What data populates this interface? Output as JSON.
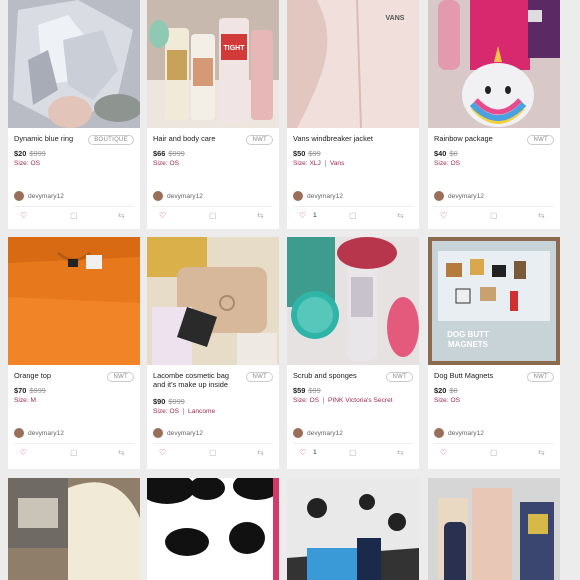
{
  "cards": [
    {
      "title": "Dynamic blue ring",
      "badge": "BOUTIQUE",
      "price": "$20",
      "orig": "$999",
      "size": "Size: OS",
      "brand": "",
      "seller": "devymary12",
      "likes": "",
      "img": "ice",
      "icons": {
        "like": "heart-icon",
        "comment": "comment-icon",
        "share": "share-icon"
      }
    },
    {
      "title": "Hair and body care",
      "badge": "NWT",
      "price": "$66",
      "orig": "$999",
      "size": "Size: OS",
      "brand": "",
      "seller": "devymary12",
      "likes": "",
      "img": "bottles"
    },
    {
      "title": "Vans windbreaker jacket",
      "badge": "",
      "price": "$50",
      "orig": "$99",
      "size": "Size: XLJ",
      "brand": "Vans",
      "seller": "devymary12",
      "likes": "1",
      "img": "pink"
    },
    {
      "title": "Rainbow package",
      "badge": "NWT",
      "price": "$40",
      "orig": "$0",
      "size": "Size: OS",
      "brand": "",
      "seller": "devymary12",
      "likes": "",
      "img": "unicorn"
    },
    {
      "title": "Orange top",
      "badge": "NWT",
      "price": "$70",
      "orig": "$999",
      "size": "Size: M",
      "brand": "",
      "seller": "devymary12",
      "likes": "",
      "img": "orange"
    },
    {
      "title": "Lacombe cosmetic bag and it's make up inside",
      "badge": "NWT",
      "price": "$90",
      "orig": "$999",
      "size": "Size: OS",
      "brand": "Lancome",
      "seller": "devymary12",
      "likes": "",
      "img": "bag"
    },
    {
      "title": "Scrub and sponges",
      "badge": "NWT",
      "price": "$59",
      "orig": "$99",
      "size": "Size: OS",
      "brand": "PINK Victoria's Secret",
      "seller": "devymary12",
      "likes": "1",
      "img": "teal"
    },
    {
      "title": "Dog Butt Magnets",
      "badge": "NWT",
      "price": "$20",
      "orig": "$0",
      "size": "Size: OS",
      "brand": "",
      "seller": "devymary12",
      "likes": "",
      "img": "magnets"
    },
    {
      "img": "beige"
    },
    {
      "img": "cow"
    },
    {
      "img": "blackwhite"
    },
    {
      "img": "socks"
    }
  ],
  "image_texts": {
    "vans": "VANS",
    "tight": "TIGHT",
    "dog": "DOG BUTT",
    "magnets": "MAGNETS"
  }
}
